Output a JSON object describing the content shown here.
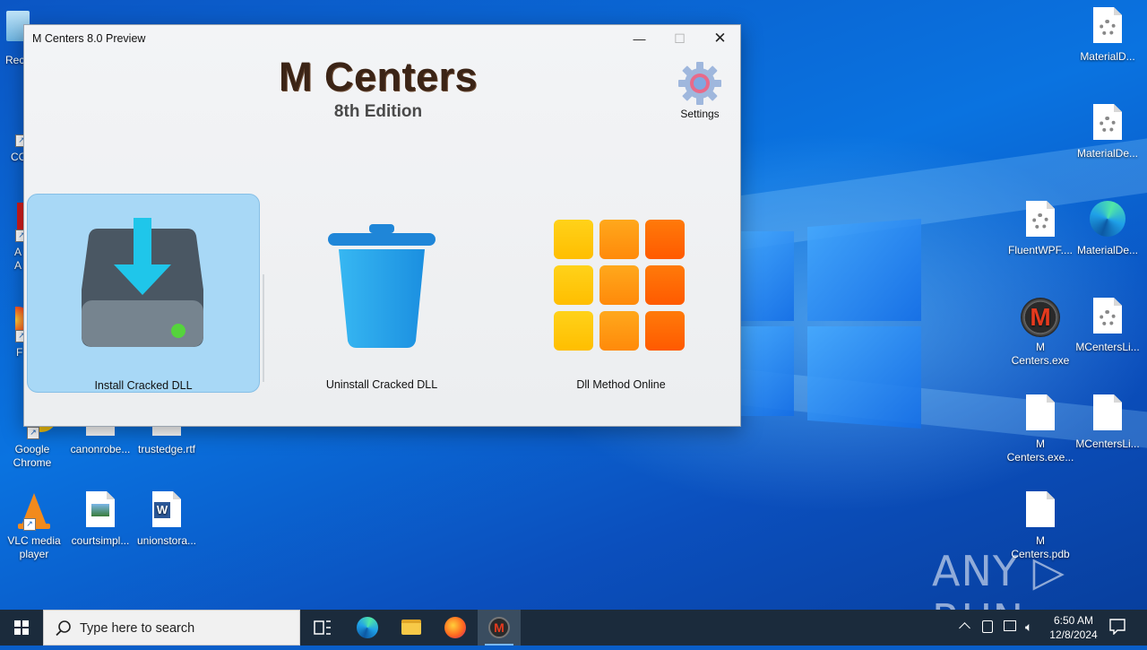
{
  "window": {
    "title": "M Centers 8.0 Preview",
    "minimize": "—",
    "maximize": "☐",
    "close": "✕"
  },
  "brand": {
    "title": "M Centers",
    "subtitle": "8th Edition"
  },
  "settings": {
    "label": "Settings"
  },
  "tiles": [
    {
      "label": "Install Cracked DLL"
    },
    {
      "label": "Uninstall Cracked DLL"
    },
    {
      "label": "Dll Method Online"
    }
  ],
  "desktop": {
    "left_icons": [
      {
        "label": "Rec"
      },
      {
        "label": "CC"
      },
      {
        "label": "A\nA"
      },
      {
        "label": "F"
      },
      {
        "label": "Google Chrome"
      },
      {
        "label": "canonrobe..."
      },
      {
        "label": "trustedge.rtf"
      },
      {
        "label": "VLC media player"
      },
      {
        "label": "courtsimpl..."
      },
      {
        "label": "unionstora..."
      }
    ],
    "right_icons": [
      {
        "label": "MaterialD..."
      },
      {
        "label": "MaterialDe..."
      },
      {
        "label": "FluentWPF...."
      },
      {
        "label": "MaterialDe..."
      },
      {
        "label": "M Centers.exe"
      },
      {
        "label": "MCentersLi..."
      },
      {
        "label": "M Centers.exe..."
      },
      {
        "label": "MCentersLi..."
      },
      {
        "label": "M Centers.pdb"
      }
    ]
  },
  "taskbar": {
    "search_placeholder": "Type here to search",
    "time": "6:50 AM",
    "date": "12/8/2024"
  },
  "watermark": "ANY ▷ RUN",
  "colors": {
    "accent": "#a8d8f6",
    "desktop_blue": "#0a5ec9",
    "taskbar": "#1b2b3c"
  }
}
